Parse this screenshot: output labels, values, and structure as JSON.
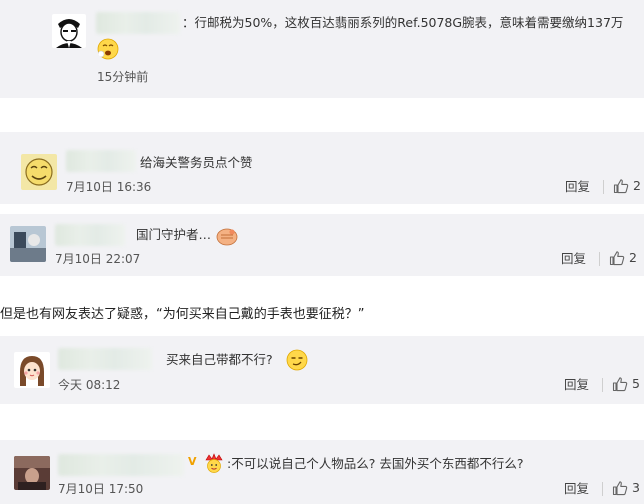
{
  "comments": [
    {
      "text": "：行邮税为50%，这枚百达翡丽系列的Ref.5078G腕表，意味着需要缴纳137万",
      "time": "15分钟前",
      "avatar_icon": "cartoon-man-avatar",
      "emoji_icon": "yawn-face-icon"
    },
    {
      "text": "给海关警务员点个赞",
      "time": "7月10日 16:36",
      "reply": "回复",
      "likes": "2",
      "avatar_icon": "yellow-doodle-avatar"
    },
    {
      "text": "国门守护者…",
      "time": "7月10日 22:07",
      "reply": "回复",
      "likes": "2",
      "avatar_icon": "photo-avatar",
      "emoji_icon": "fist-salute-icon"
    },
    {
      "text": "买来自己带都不行?",
      "time": "今天 08:12",
      "reply": "回复",
      "likes": "5",
      "avatar_icon": "cartoon-girl-avatar",
      "emoji_icon": "smirk-face-icon"
    },
    {
      "text": ":不可以说自己个人物品么? 去国外买个东西都不行么?",
      "time": "7月10日 17:50",
      "reply": "回复",
      "likes": "3",
      "avatar_icon": "dark-photo-avatar",
      "badge": "V",
      "emoji_icon": "crown-face-icon"
    }
  ],
  "article_text": "但是也有网友表达了疑惑，“为何买来自己戴的手表也要征税？”",
  "colors": {
    "panel_bg": "#f2f2f5",
    "page_bg": "#ffffff",
    "text": "#333333",
    "badge": "#f0a100"
  }
}
